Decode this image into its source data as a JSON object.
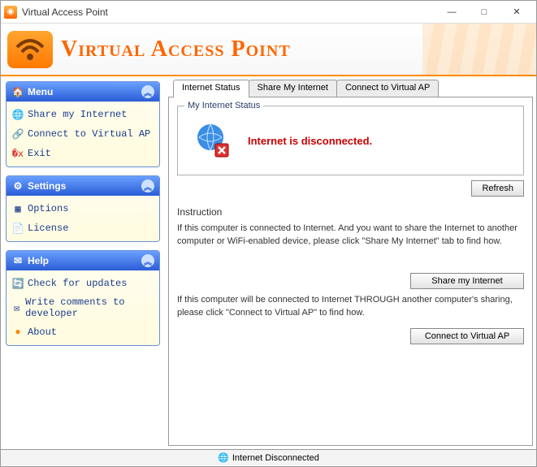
{
  "window": {
    "title": "Virtual Access Point"
  },
  "brand": {
    "name": "Virtual Access Point"
  },
  "sidebar": {
    "menu": {
      "title": "Menu",
      "items": [
        {
          "label": "Share my Internet"
        },
        {
          "label": "Connect to Virtual AP"
        },
        {
          "label": "Exit"
        }
      ]
    },
    "settings": {
      "title": "Settings",
      "items": [
        {
          "label": "Options"
        },
        {
          "label": "License"
        }
      ]
    },
    "help": {
      "title": "Help",
      "items": [
        {
          "label": "Check for updates"
        },
        {
          "label": "Write comments to developer"
        },
        {
          "label": "About"
        }
      ]
    }
  },
  "tabs": [
    {
      "label": "Internet Status"
    },
    {
      "label": "Share My Internet"
    },
    {
      "label": "Connect to Virtual AP"
    }
  ],
  "status": {
    "groupTitle": "My Internet Status",
    "message": "Internet is disconnected.",
    "refresh": "Refresh"
  },
  "instruction": {
    "heading": "Instruction",
    "para1": "If this computer is connected to Internet. And you want to share the Internet to another computer or WiFi-enabled device, please click \"Share My Internet\" tab to find how.",
    "btn1": "Share my Internet",
    "para2": "If this computer will be connected to Internet THROUGH another computer's sharing, please click \"Connect to Virtual AP\" to find how.",
    "btn2": "Connect to Virtual AP"
  },
  "statusbar": {
    "text": "Internet Disconnected"
  }
}
